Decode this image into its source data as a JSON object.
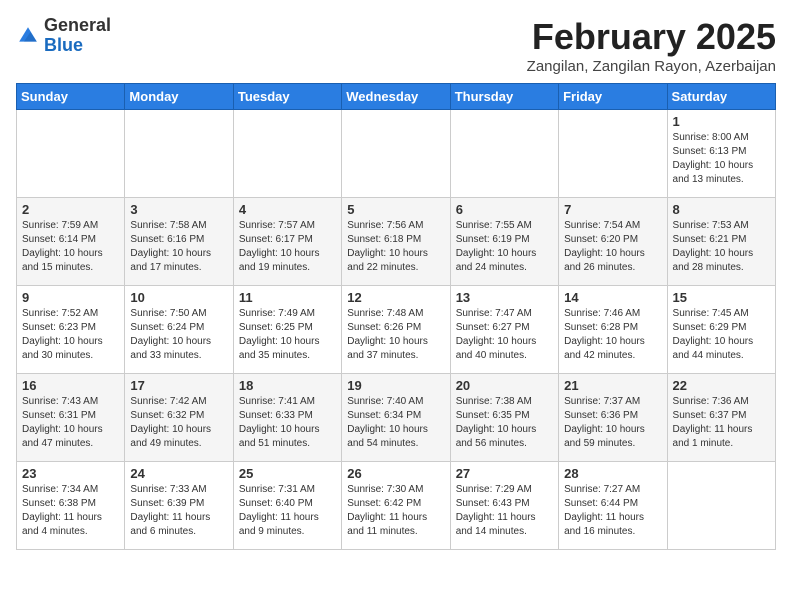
{
  "header": {
    "logo_line1": "General",
    "logo_line2": "Blue",
    "month_title": "February 2025",
    "subtitle": "Zangilan, Zangilan Rayon, Azerbaijan"
  },
  "weekdays": [
    "Sunday",
    "Monday",
    "Tuesday",
    "Wednesday",
    "Thursday",
    "Friday",
    "Saturday"
  ],
  "weeks": [
    [
      {
        "day": "",
        "info": ""
      },
      {
        "day": "",
        "info": ""
      },
      {
        "day": "",
        "info": ""
      },
      {
        "day": "",
        "info": ""
      },
      {
        "day": "",
        "info": ""
      },
      {
        "day": "",
        "info": ""
      },
      {
        "day": "1",
        "info": "Sunrise: 8:00 AM\nSunset: 6:13 PM\nDaylight: 10 hours\nand 13 minutes."
      }
    ],
    [
      {
        "day": "2",
        "info": "Sunrise: 7:59 AM\nSunset: 6:14 PM\nDaylight: 10 hours\nand 15 minutes."
      },
      {
        "day": "3",
        "info": "Sunrise: 7:58 AM\nSunset: 6:16 PM\nDaylight: 10 hours\nand 17 minutes."
      },
      {
        "day": "4",
        "info": "Sunrise: 7:57 AM\nSunset: 6:17 PM\nDaylight: 10 hours\nand 19 minutes."
      },
      {
        "day": "5",
        "info": "Sunrise: 7:56 AM\nSunset: 6:18 PM\nDaylight: 10 hours\nand 22 minutes."
      },
      {
        "day": "6",
        "info": "Sunrise: 7:55 AM\nSunset: 6:19 PM\nDaylight: 10 hours\nand 24 minutes."
      },
      {
        "day": "7",
        "info": "Sunrise: 7:54 AM\nSunset: 6:20 PM\nDaylight: 10 hours\nand 26 minutes."
      },
      {
        "day": "8",
        "info": "Sunrise: 7:53 AM\nSunset: 6:21 PM\nDaylight: 10 hours\nand 28 minutes."
      }
    ],
    [
      {
        "day": "9",
        "info": "Sunrise: 7:52 AM\nSunset: 6:23 PM\nDaylight: 10 hours\nand 30 minutes."
      },
      {
        "day": "10",
        "info": "Sunrise: 7:50 AM\nSunset: 6:24 PM\nDaylight: 10 hours\nand 33 minutes."
      },
      {
        "day": "11",
        "info": "Sunrise: 7:49 AM\nSunset: 6:25 PM\nDaylight: 10 hours\nand 35 minutes."
      },
      {
        "day": "12",
        "info": "Sunrise: 7:48 AM\nSunset: 6:26 PM\nDaylight: 10 hours\nand 37 minutes."
      },
      {
        "day": "13",
        "info": "Sunrise: 7:47 AM\nSunset: 6:27 PM\nDaylight: 10 hours\nand 40 minutes."
      },
      {
        "day": "14",
        "info": "Sunrise: 7:46 AM\nSunset: 6:28 PM\nDaylight: 10 hours\nand 42 minutes."
      },
      {
        "day": "15",
        "info": "Sunrise: 7:45 AM\nSunset: 6:29 PM\nDaylight: 10 hours\nand 44 minutes."
      }
    ],
    [
      {
        "day": "16",
        "info": "Sunrise: 7:43 AM\nSunset: 6:31 PM\nDaylight: 10 hours\nand 47 minutes."
      },
      {
        "day": "17",
        "info": "Sunrise: 7:42 AM\nSunset: 6:32 PM\nDaylight: 10 hours\nand 49 minutes."
      },
      {
        "day": "18",
        "info": "Sunrise: 7:41 AM\nSunset: 6:33 PM\nDaylight: 10 hours\nand 51 minutes."
      },
      {
        "day": "19",
        "info": "Sunrise: 7:40 AM\nSunset: 6:34 PM\nDaylight: 10 hours\nand 54 minutes."
      },
      {
        "day": "20",
        "info": "Sunrise: 7:38 AM\nSunset: 6:35 PM\nDaylight: 10 hours\nand 56 minutes."
      },
      {
        "day": "21",
        "info": "Sunrise: 7:37 AM\nSunset: 6:36 PM\nDaylight: 10 hours\nand 59 minutes."
      },
      {
        "day": "22",
        "info": "Sunrise: 7:36 AM\nSunset: 6:37 PM\nDaylight: 11 hours\nand 1 minute."
      }
    ],
    [
      {
        "day": "23",
        "info": "Sunrise: 7:34 AM\nSunset: 6:38 PM\nDaylight: 11 hours\nand 4 minutes."
      },
      {
        "day": "24",
        "info": "Sunrise: 7:33 AM\nSunset: 6:39 PM\nDaylight: 11 hours\nand 6 minutes."
      },
      {
        "day": "25",
        "info": "Sunrise: 7:31 AM\nSunset: 6:40 PM\nDaylight: 11 hours\nand 9 minutes."
      },
      {
        "day": "26",
        "info": "Sunrise: 7:30 AM\nSunset: 6:42 PM\nDaylight: 11 hours\nand 11 minutes."
      },
      {
        "day": "27",
        "info": "Sunrise: 7:29 AM\nSunset: 6:43 PM\nDaylight: 11 hours\nand 14 minutes."
      },
      {
        "day": "28",
        "info": "Sunrise: 7:27 AM\nSunset: 6:44 PM\nDaylight: 11 hours\nand 16 minutes."
      },
      {
        "day": "",
        "info": ""
      }
    ]
  ]
}
